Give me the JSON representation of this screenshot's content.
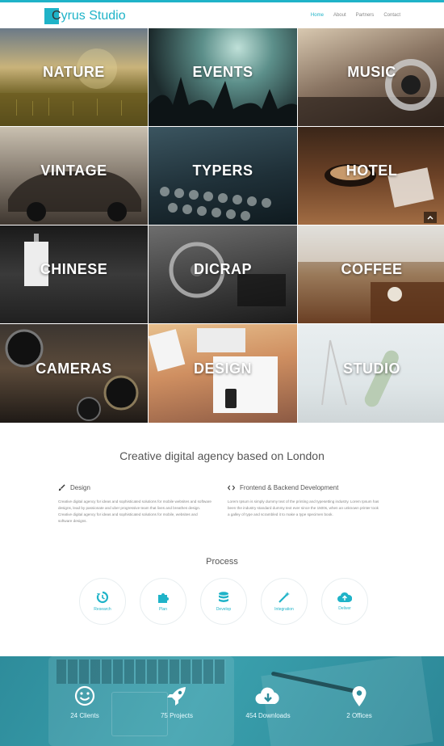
{
  "brand": {
    "name_first": "C",
    "name_rest": "yrus Studio",
    "accent": "#1fb3c8"
  },
  "nav": {
    "items": [
      "Home",
      "About",
      "Partners",
      "Contact"
    ],
    "active": "Home"
  },
  "portfolio": {
    "tiles": [
      {
        "label": "NATURE"
      },
      {
        "label": "EVENTS"
      },
      {
        "label": "MUSIC"
      },
      {
        "label": "VINTAGE"
      },
      {
        "label": "TYPERS"
      },
      {
        "label": "HOTEL"
      },
      {
        "label": "CHINESE"
      },
      {
        "label": "DICRAP"
      },
      {
        "label": "COFFEE"
      },
      {
        "label": "CAMERAS"
      },
      {
        "label": "DESIGN"
      },
      {
        "label": "STUDIO"
      }
    ],
    "scroll_top_icon": "chevron-up-icon"
  },
  "intro": {
    "title": "Creative digital agency based on London",
    "left": {
      "icon": "brush-icon",
      "heading": "Design",
      "text": "Creative digital agency for ideas and sophisticated solutions for mobile websites and software designs, lead by passionate and uber progressive team that lives and breathes design. Creative digital agency for ideas and sophisticated solutions for mobile, websites and software designs."
    },
    "right": {
      "icon": "code-icon",
      "heading": "Frontend & Backend Development",
      "text": "Lorem Ipsum is simply dummy text of the printing and typesetting industry. Lorem Ipsum has been the industry standard dummy text ever since the 1500s, when an unknown printer took a galley of type and scrambled it to make a type specimen book."
    }
  },
  "process": {
    "title": "Process",
    "steps": [
      {
        "label": "Research",
        "icon": "history-icon"
      },
      {
        "label": "Plan",
        "icon": "puzzle-icon"
      },
      {
        "label": "Develop",
        "icon": "database-icon"
      },
      {
        "label": "Integration",
        "icon": "magic-icon"
      },
      {
        "label": "Deliver",
        "icon": "cloud-upload-icon"
      }
    ]
  },
  "stats": [
    {
      "label": "24 Clients",
      "icon": "smile-icon"
    },
    {
      "label": "75 Projects",
      "icon": "rocket-icon"
    },
    {
      "label": "454 Downloads",
      "icon": "cloud-download-icon"
    },
    {
      "label": "2 Offices",
      "icon": "map-marker-icon"
    }
  ]
}
